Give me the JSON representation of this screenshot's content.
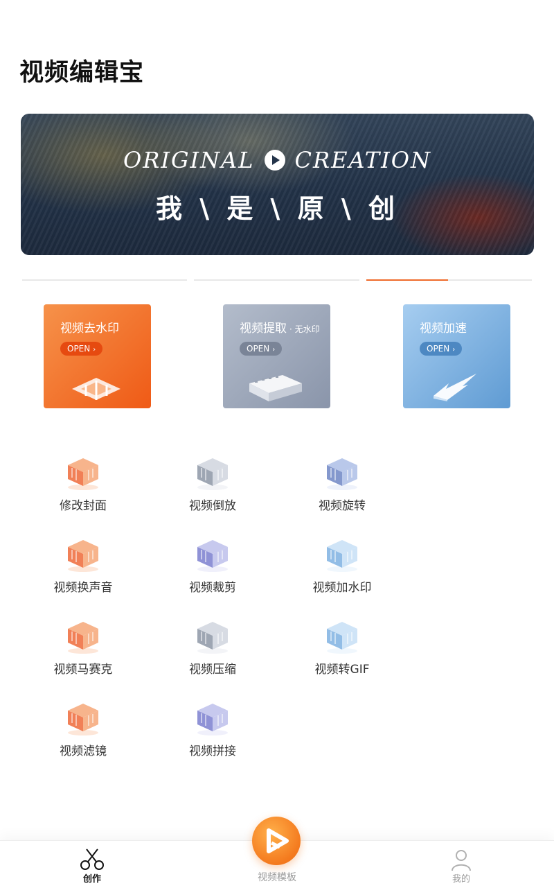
{
  "app": {
    "title": "视频编辑宝"
  },
  "banner": {
    "word_left": "ORIGINAL",
    "word_right": "CREATION",
    "subtitle": "我 \\ 是 \\ 原 \\ 创"
  },
  "features": [
    {
      "title": "视频去水印",
      "note": "",
      "open": "OPEN",
      "color_start": "#f6924a",
      "color_end": "#ef5a16",
      "badge_color": "#e64a10"
    },
    {
      "title": "视频提取",
      "note": "· 无水印",
      "open": "OPEN",
      "color_start": "#b3bccb",
      "color_end": "#8a95aa",
      "badge_color": "#7a8497"
    },
    {
      "title": "视频加速",
      "note": "",
      "open": "OPEN",
      "color_start": "#a6cdf0",
      "color_end": "#5f9bd3",
      "badge_color": "#4d88c2"
    }
  ],
  "tools": [
    {
      "label": "修改封面",
      "icon": "cover-icon",
      "tone": "orange"
    },
    {
      "label": "视频倒放",
      "icon": "reverse-icon",
      "tone": "gray"
    },
    {
      "label": "视频旋转",
      "icon": "rotate-icon",
      "tone": "blue"
    },
    {
      "label": "视频换声音",
      "icon": "audio-icon",
      "tone": "orange"
    },
    {
      "label": "视频裁剪",
      "icon": "scissors-icon",
      "tone": "purple"
    },
    {
      "label": "视频加水印",
      "icon": "watermark-icon",
      "tone": "lightblue"
    },
    {
      "label": "视频马赛克",
      "icon": "mosaic-icon",
      "tone": "orange"
    },
    {
      "label": "视频压缩",
      "icon": "compress-icon",
      "tone": "gray"
    },
    {
      "label": "视频转GIF",
      "icon": "gif-icon",
      "tone": "lightblue"
    },
    {
      "label": "视频滤镜",
      "icon": "filter-icon",
      "tone": "orange"
    },
    {
      "label": "视频拼接",
      "icon": "merge-icon",
      "tone": "purple"
    }
  ],
  "nav": {
    "create": "创作",
    "templates": "视频模板",
    "mine": "我的"
  },
  "colors": {
    "accent": "#ef6a2a",
    "nav_active": "#111111",
    "nav_inactive": "#9a9a9a"
  }
}
